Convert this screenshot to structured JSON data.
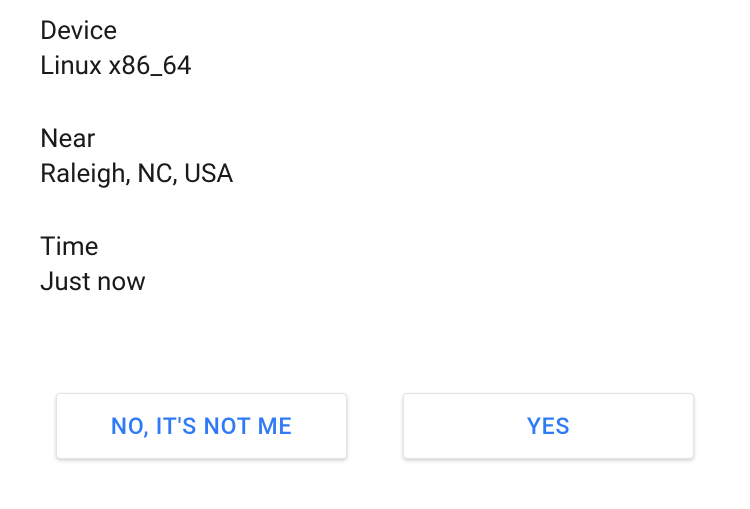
{
  "info": {
    "device": {
      "label": "Device",
      "value": "Linux x86_64"
    },
    "near": {
      "label": "Near",
      "value": "Raleigh, NC, USA"
    },
    "time": {
      "label": "Time",
      "value": "Just now"
    }
  },
  "buttons": {
    "no_label": "NO, IT'S NOT ME",
    "yes_label": "YES"
  }
}
